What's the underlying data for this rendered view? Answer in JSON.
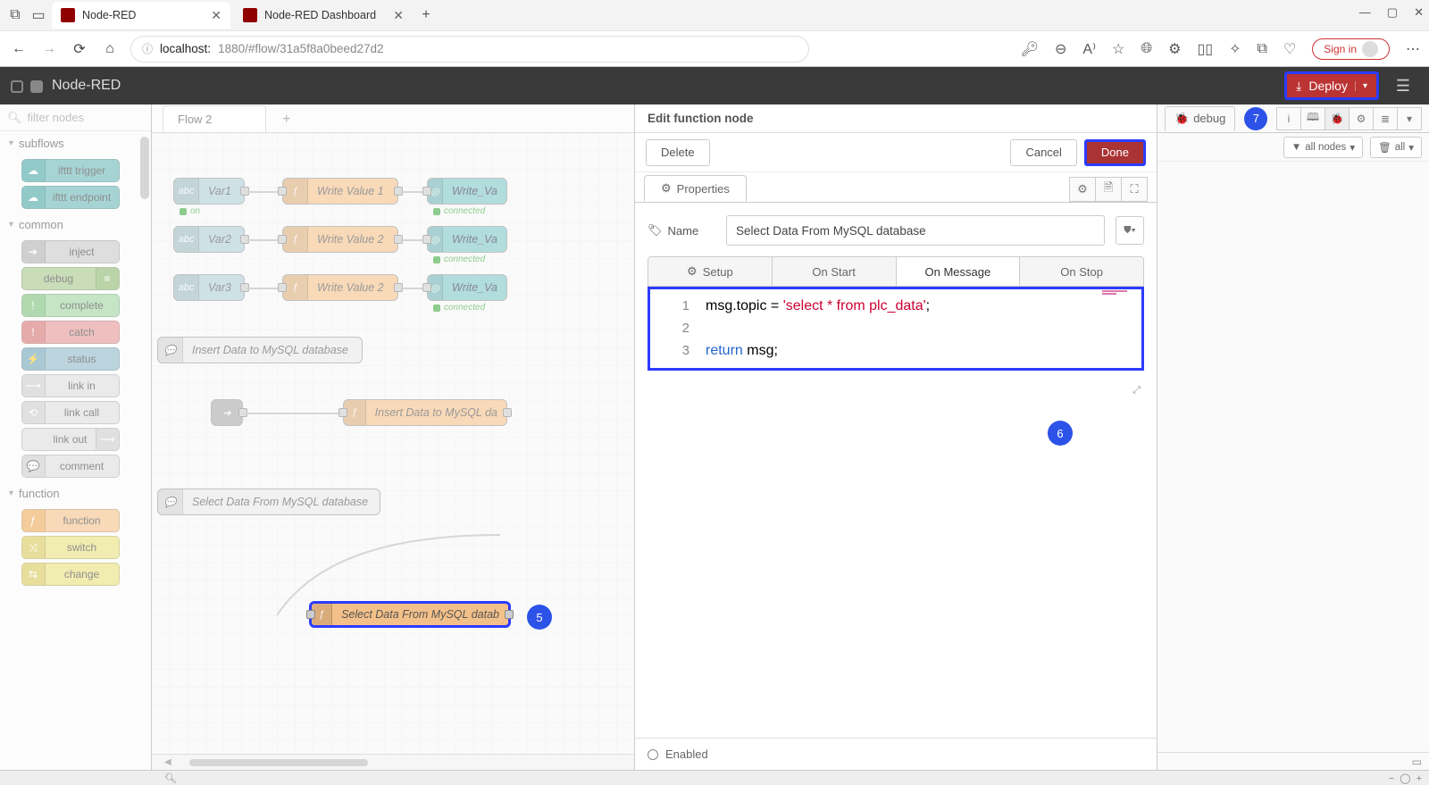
{
  "browser": {
    "tabs": [
      {
        "title": "Node-RED",
        "active": true
      },
      {
        "title": "Node-RED Dashboard",
        "active": false
      }
    ],
    "url_host": "localhost:",
    "url_rest": "1880/#flow/31a5f8a0beed27d2",
    "signin": "Sign in"
  },
  "header": {
    "title": "Node-RED",
    "deploy": "Deploy"
  },
  "palette": {
    "filter_placeholder": "filter nodes",
    "cat_subflows": "subflows",
    "cat_common": "common",
    "cat_function": "function",
    "nodes": {
      "ifttt_trigger": "ifttt trigger",
      "ifttt_endpoint": "ifttt endpoint",
      "inject": "inject",
      "debug": "debug",
      "complete": "complete",
      "catch": "catch",
      "status": "status",
      "link_in": "link in",
      "link_call": "link call",
      "link_out": "link out",
      "comment": "comment",
      "function": "function",
      "switch": "switch",
      "change": "change"
    }
  },
  "workspace": {
    "tab": "Flow 2",
    "nodes": {
      "var1": "Var1",
      "var2": "Var2",
      "var3": "Var3",
      "on": "on",
      "connected": "connected",
      "wv1": "Write Value 1",
      "wv2": "Write Value 2",
      "wv2b": "Write Value 2",
      "wva": "Write_Va",
      "insert_cmt": "Insert Data to MySQL database",
      "insert_fn": "Insert Data to MySQL da",
      "select_cmt": "Select Data From MySQL database",
      "select_fn": "Select Data From MySQL datab"
    }
  },
  "edit": {
    "title": "Edit function node",
    "delete": "Delete",
    "cancel": "Cancel",
    "done": "Done",
    "properties_tab": "Properties",
    "name_label": "Name",
    "name_value": "Select Data From MySQL database",
    "code_tabs": {
      "setup": "Setup",
      "on_start": "On Start",
      "on_message": "On Message",
      "on_stop": "On Stop"
    },
    "code": {
      "l1a": "msg.topic = ",
      "l1b": "'select * from plc_data'",
      "l1c": ";",
      "l3a": "return",
      "l3b": " msg;"
    },
    "enabled": "Enabled"
  },
  "sidebar": {
    "debug": "debug",
    "all_nodes": "all nodes",
    "all": "all"
  },
  "steps": {
    "s5": "5",
    "s6": "6",
    "s7": "7"
  }
}
